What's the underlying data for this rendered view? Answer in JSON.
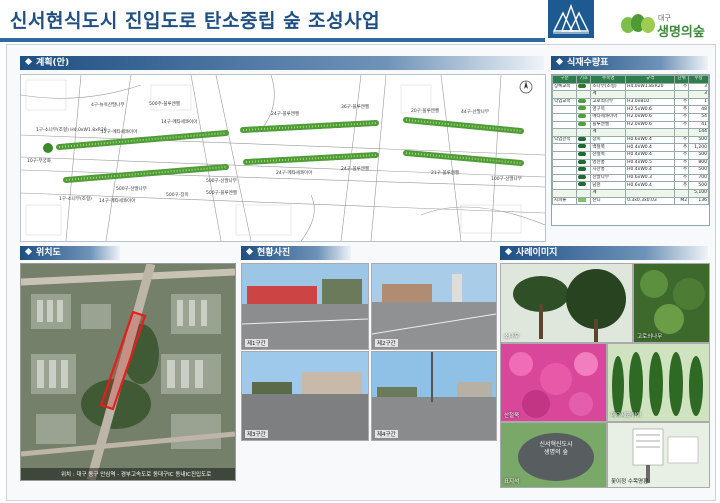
{
  "header": {
    "title": "신서현식도시 진입도로 탄소중립 숲 조성사업",
    "brand_sub": "대구",
    "brand": "생명의숲"
  },
  "sections": {
    "plan": "계획(안)",
    "materials": "식재수량표",
    "location": "위치도",
    "photos": "현황사진",
    "examples": "사례이미지"
  },
  "plan_labels": [
    "1구-소나무(조형) H4.0xW1.8xR20",
    "4구-뉴욕산딸나무",
    "14구-메타세콰이아",
    "12구-메타세콰이아",
    "500주-블루엔젤",
    "24구-블루엔젤",
    "36구-블루엔젤",
    "44구-산딸나무",
    "24구-메타세콰이아",
    "500구-산딸나무",
    "20구-블루엔젤",
    "10구-무궁화",
    "500구-산딸나무",
    "1구-소나무(조형)",
    "14구-메타세콰이아",
    "500구-장미",
    "24구-블루엔젤",
    "21구-블루엔젤",
    "100구-산딸나무",
    "500구-블루엔젤"
  ],
  "materials": {
    "columns": [
      "구분",
      "기호",
      "수목명",
      "규격",
      "단위",
      "수량"
    ],
    "rows": [
      [
        "상록교목",
        "pine",
        "소나무(조형)",
        "H4.0xW1.8xR20",
        "주",
        "3"
      ],
      [
        "",
        "",
        "계",
        "",
        "",
        "3"
      ],
      [
        "낙엽교목",
        "tree",
        "고로쇠나무",
        "H3.0xB10",
        "주",
        "1"
      ],
      [
        "",
        "tree",
        "영구목",
        "H2.5xW0.6",
        "주",
        "48"
      ],
      [
        "",
        "tree",
        "메타세콰이아",
        "H2.0xW0.6",
        "주",
        "54"
      ],
      [
        "",
        "tree",
        "블루엔젤",
        "H2.0xW0.6",
        "주",
        "41"
      ],
      [
        "",
        "",
        "계",
        "",
        "",
        "144"
      ],
      [
        "낙엽관목",
        "shrub",
        "장미",
        "H0.6xW0.4",
        "주",
        "500"
      ],
      [
        "",
        "shrub",
        "백철쭉",
        "H0.4xW0.4",
        "주",
        "1,200"
      ],
      [
        "",
        "shrub",
        "산철쭉",
        "H0.4xW0.4",
        "주",
        "500"
      ],
      [
        "",
        "shrub",
        "영산홍",
        "H0.4xW0.5",
        "주",
        "800"
      ],
      [
        "",
        "shrub",
        "자산홍",
        "H0.4xW0.4",
        "주",
        "500"
      ],
      [
        "",
        "shrub",
        "산딸나무",
        "H0.6xW0.3",
        "주",
        "700"
      ],
      [
        "",
        "shrub",
        "남천",
        "H0.6xW0.4",
        "주",
        "500"
      ],
      [
        "",
        "",
        "계",
        "",
        "",
        "5,100"
      ],
      [
        "지피류",
        "grass",
        "잔디",
        "0.3x0.3x0.03",
        "M2",
        "136"
      ]
    ]
  },
  "map": {
    "caption": "위치 : 대구 동구 안심역 - 경부고속도로 동대구IC 동내IC진입도로"
  },
  "photos": [
    "제1구간",
    "제2구간",
    "제3구간",
    "제4구간"
  ],
  "examples": [
    "소나무",
    "고로쇠나무",
    "산철쭉",
    "메타세콰이아",
    "표지석",
    "꽃이정 수목명판"
  ],
  "stone_text": "신서혁신도시\n생명의 숲",
  "colors": {
    "title_blue": "#1f4f82",
    "brand_green": "#3f8a3a",
    "route_red": "#e0201c"
  }
}
